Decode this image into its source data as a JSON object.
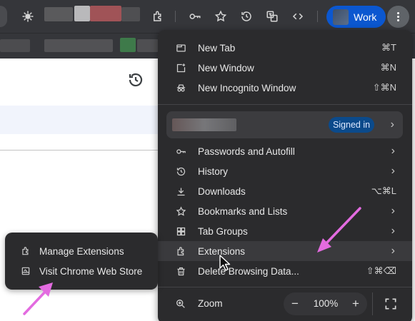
{
  "toolbar": {
    "profile_label": "Work",
    "icons": [
      "extensions-icon",
      "key-icon",
      "star-icon",
      "history-icon",
      "translate-icon",
      "code-icon"
    ]
  },
  "menu": {
    "items_top": [
      {
        "label": "New Tab",
        "shortcut": "⌘T"
      },
      {
        "label": "New Window",
        "shortcut": "⌘N"
      },
      {
        "label": "New Incognito Window",
        "shortcut": "⇧⌘N"
      }
    ],
    "profile": {
      "status": "Signed in"
    },
    "items_mid": [
      {
        "label": "Passwords and Autofill"
      },
      {
        "label": "History"
      },
      {
        "label": "Downloads",
        "shortcut": "⌥⌘L"
      },
      {
        "label": "Bookmarks and Lists"
      },
      {
        "label": "Tab Groups"
      },
      {
        "label": "Extensions"
      },
      {
        "label": "Delete Browsing Data...",
        "shortcut": "⇧⌘⌫"
      }
    ],
    "zoom": {
      "label": "Zoom",
      "minus": "−",
      "value": "100%",
      "plus": "+"
    }
  },
  "submenu": {
    "items": [
      {
        "label": "Manage Extensions"
      },
      {
        "label": "Visit Chrome Web Store"
      }
    ]
  },
  "colors": {
    "menu_bg": "#2b2b2d",
    "accent": "#0b57d0",
    "annotation": "#e36be0"
  }
}
